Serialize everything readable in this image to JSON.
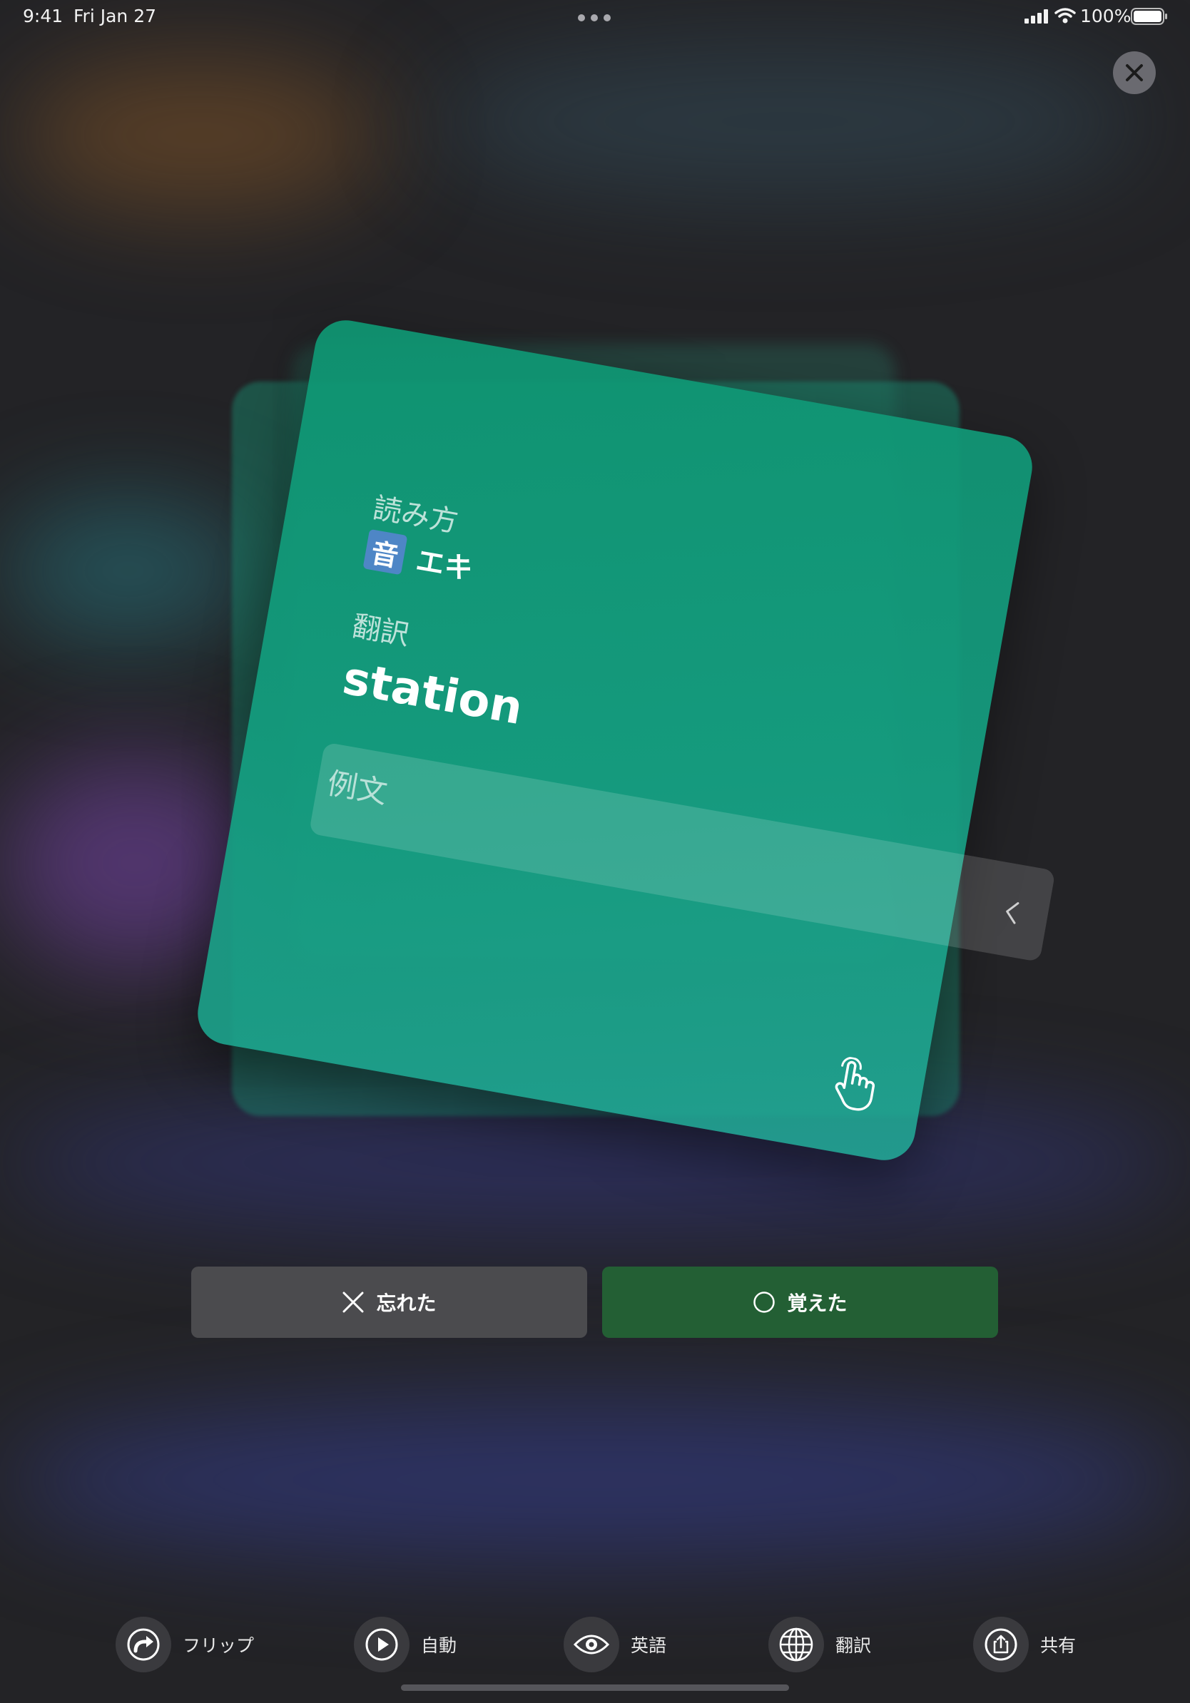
{
  "status_bar": {
    "time": "9:41",
    "date": "Fri Jan 27",
    "battery": "100%"
  },
  "card": {
    "reading_label": "読み方",
    "reading_badge": "音",
    "reading_value": "エキ",
    "translation_label": "翻訳",
    "translation_value": "station",
    "example_label": "例文"
  },
  "actions": {
    "forgot_label": "忘れた",
    "remembered_label": "覚えた"
  },
  "toolbar": {
    "items": [
      {
        "label": "フリップ",
        "icon": "flip-icon"
      },
      {
        "label": "自動",
        "icon": "play-icon"
      },
      {
        "label": "英語",
        "icon": "eye-icon"
      },
      {
        "label": "翻訳",
        "icon": "globe-icon"
      },
      {
        "label": "共有",
        "icon": "share-icon"
      }
    ]
  },
  "colors": {
    "card": "#0e9672",
    "forgot_button": "#4b4b4e",
    "remembered_button": "#235f34",
    "reading_badge": "#4e86c6"
  }
}
